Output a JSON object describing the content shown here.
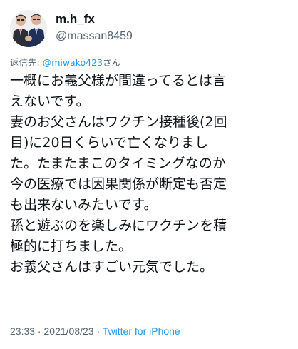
{
  "user": {
    "display_name": "m.h_fx",
    "handle": "@massan8459"
  },
  "reply": {
    "prefix": "返信先: ",
    "mention": "@miwako423",
    "suffix": "さん"
  },
  "body_lines": [
    "一概にお義父様が間違ってるとは言",
    "えないです。",
    "妻のお父さんはワクチン接種後(2回",
    "目)に20日くらいで亡くなりまし",
    "た。たまたまこのタイミングなのか",
    "今の医療では因果関係が断定も否定",
    "も出来ないみたいです。",
    "孫と遊ぶのを楽しみにワクチンを積",
    "極的に打ちました。",
    "お義父さんはすごい元気でした。"
  ],
  "meta": {
    "time": "23:33",
    "separator": " · ",
    "date": "2021/08/23",
    "separator2": " · ",
    "source": "Twitter for iPhone"
  },
  "colors": {
    "text": "#0f1419",
    "secondary": "#536471",
    "link": "#1d9bf0"
  }
}
